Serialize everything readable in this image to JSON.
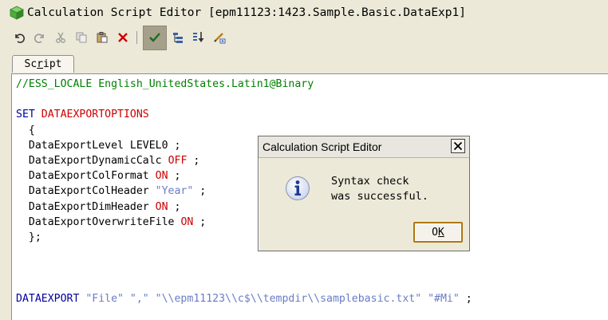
{
  "window": {
    "title": "Calculation Script Editor [epm11123:1423.Sample.Basic.DataExp1]"
  },
  "toolbar": {
    "buttons": [
      "undo-icon",
      "redo-icon",
      "cut-icon",
      "copy-icon",
      "paste-icon",
      "delete-icon",
      "check-syntax-icon",
      "outline-icon",
      "download-icon",
      "edit-icon"
    ],
    "active": "check-syntax-icon"
  },
  "tabs": [
    {
      "label": "Script",
      "shortcut": "r"
    }
  ],
  "editor": {
    "lines": [
      {
        "y": 0,
        "parts": [
          {
            "c": "cmt",
            "t": "//ESS_LOCALE English_UnitedStates.Latin1@Binary"
          }
        ]
      },
      {
        "y": 2,
        "parts": [
          {
            "c": "kw",
            "t": "SET "
          },
          {
            "c": "red",
            "t": "DATAEXPORTOPTIONS"
          }
        ]
      },
      {
        "y": 3,
        "parts": [
          {
            "c": "blk",
            "t": "  {"
          }
        ]
      },
      {
        "y": 4,
        "parts": [
          {
            "c": "blk",
            "t": "  DataExportLevel LEVEL0 ;"
          }
        ]
      },
      {
        "y": 5,
        "parts": [
          {
            "c": "blk",
            "t": "  DataExportDynamicCalc "
          },
          {
            "c": "red",
            "t": "OFF"
          },
          {
            "c": "blk",
            "t": " ;"
          }
        ]
      },
      {
        "y": 6,
        "parts": [
          {
            "c": "blk",
            "t": "  DataExportColFormat "
          },
          {
            "c": "red",
            "t": "ON"
          },
          {
            "c": "blk",
            "t": " ;"
          }
        ]
      },
      {
        "y": 7,
        "parts": [
          {
            "c": "blk",
            "t": "  DataExportColHeader "
          },
          {
            "c": "str",
            "t": "\"Year\""
          },
          {
            "c": "blk",
            "t": " ;"
          }
        ]
      },
      {
        "y": 8,
        "parts": [
          {
            "c": "blk",
            "t": "  DataExportDimHeader "
          },
          {
            "c": "red",
            "t": "ON"
          },
          {
            "c": "blk",
            "t": " ;"
          }
        ]
      },
      {
        "y": 9,
        "parts": [
          {
            "c": "blk",
            "t": "  DataExportOverwriteFile "
          },
          {
            "c": "red",
            "t": "ON"
          },
          {
            "c": "blk",
            "t": " ;"
          }
        ]
      },
      {
        "y": 10,
        "parts": [
          {
            "c": "blk",
            "t": "  };"
          }
        ]
      },
      {
        "y": 14,
        "parts": [
          {
            "c": "kw",
            "t": "DATAEXPORT "
          },
          {
            "c": "str",
            "t": "\"File\" \",\" \"\\\\epm11123\\\\c$\\\\tempdir\\\\samplebasic.txt\" \"#Mi\""
          },
          {
            "c": "blk",
            "t": " ;"
          }
        ]
      }
    ]
  },
  "dialog": {
    "title": "Calculation Script Editor",
    "message_line1": "Syntax check",
    "message_line2": "was successful.",
    "ok_label": "OK",
    "icon": "info-icon"
  },
  "colors": {
    "comment": "#008000",
    "keyword": "#0000a0",
    "function": "#cc0000",
    "string": "#6b7cc7",
    "active_tool": "#a59f8c"
  }
}
